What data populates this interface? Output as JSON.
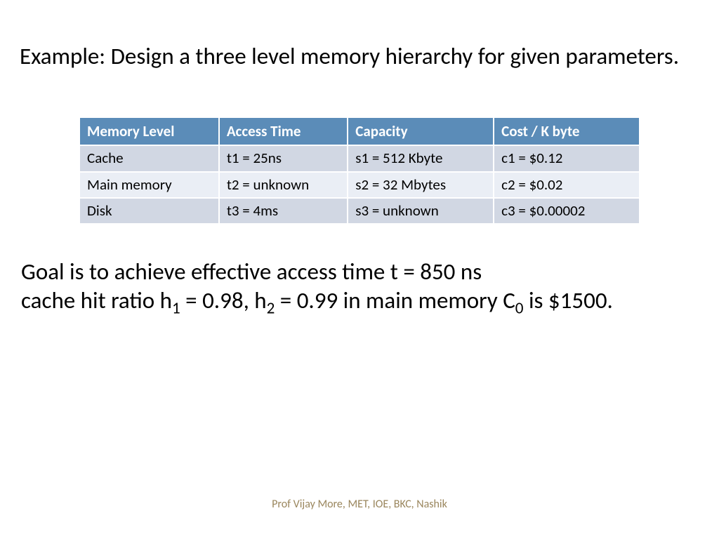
{
  "title": "Example: Design a three level memory hierarchy for given parameters.",
  "table": {
    "headers": {
      "level": "Memory Level",
      "access": "Access Time",
      "capacity": "Capacity",
      "cost": "Cost / K byte"
    },
    "rows": [
      {
        "level": "Cache",
        "access": "t1 = 25ns",
        "capacity": "s1 = 512 Kbyte",
        "cost": "c1 = $0.12"
      },
      {
        "level": "Main memory",
        "access": "t2 = unknown",
        "capacity": "s2 = 32 Mbytes",
        "cost": "c2 = $0.02"
      },
      {
        "level": "Disk",
        "access": "t3 = 4ms",
        "capacity": "s3 = unknown",
        "cost": "c3 = $0.00002"
      }
    ]
  },
  "goal": {
    "line1_pre": "Goal is to achieve effective access time t = 850 ns",
    "line2_a": "cache hit ratio h",
    "line2_sub1": "1",
    "line2_b": " = 0.98, h",
    "line2_sub2": "2",
    "line2_c": " = 0.99 in main memory C",
    "line2_sub3": "0",
    "line2_d": " is $1500."
  },
  "footer": "Prof Vijay More, MET, IOE, BKC, Nashik"
}
